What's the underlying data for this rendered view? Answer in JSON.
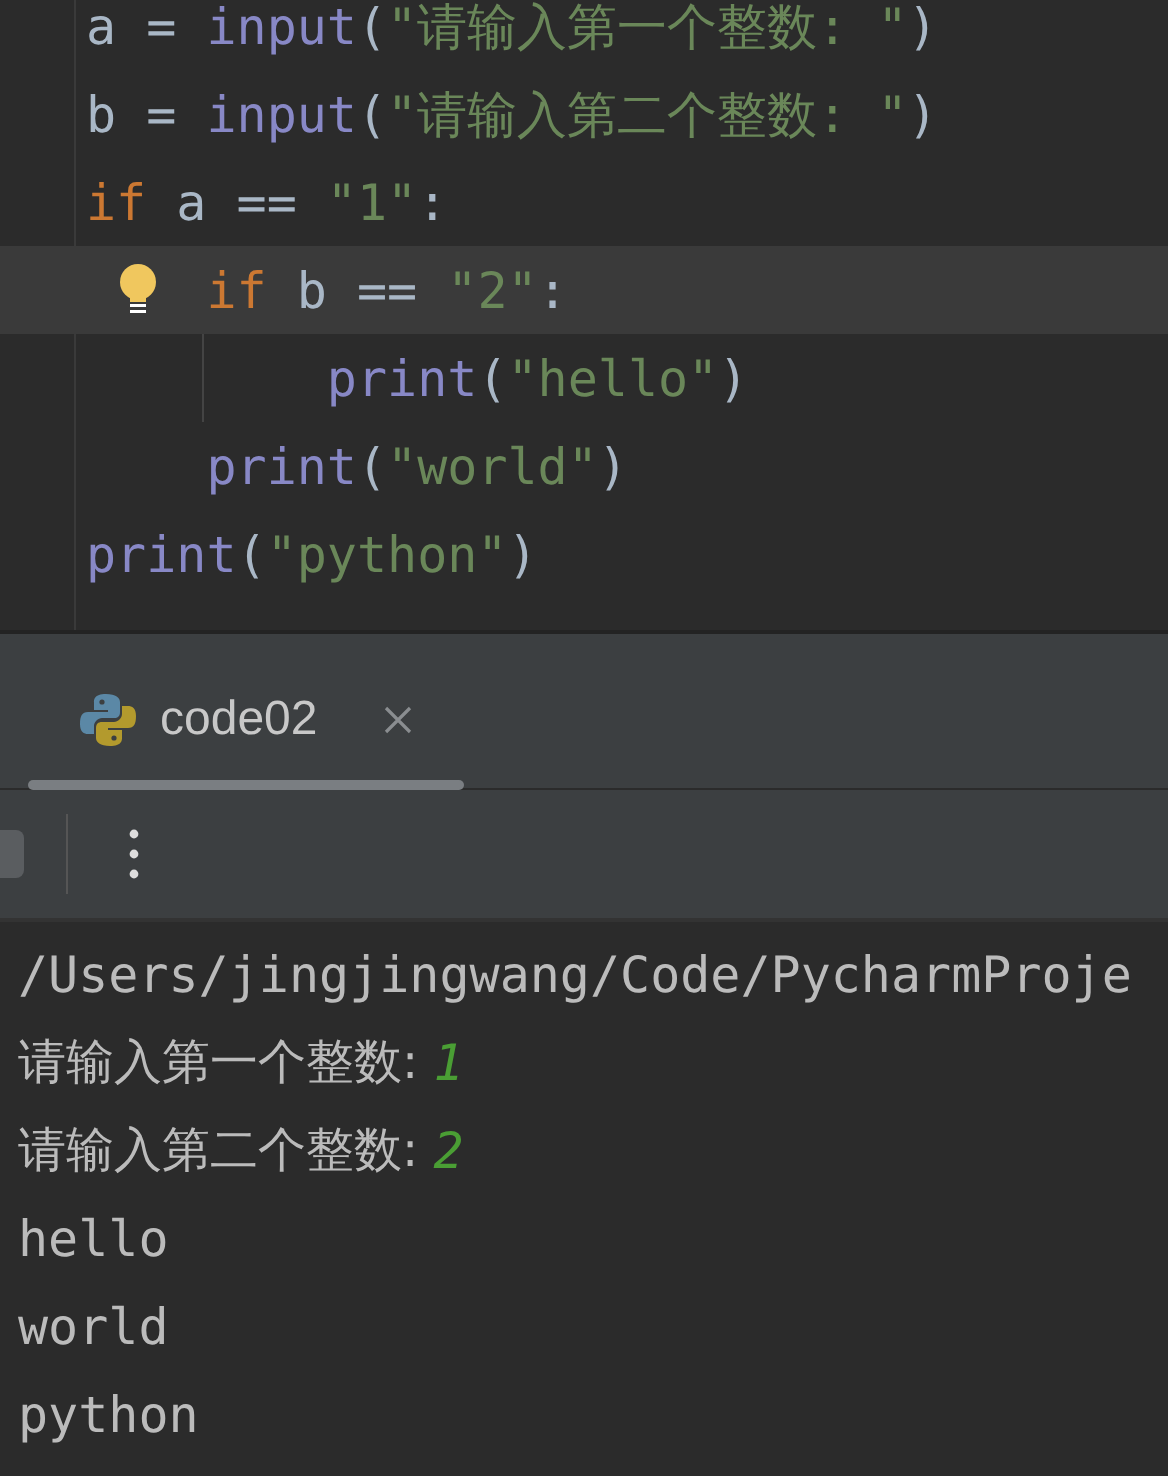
{
  "editor": {
    "lines": [
      {
        "highlighted": false,
        "bulb": false,
        "guide": false,
        "tokens": [
          {
            "kind": "plain",
            "text": "a = "
          },
          {
            "kind": "builtin",
            "text": "input"
          },
          {
            "kind": "plain",
            "text": "("
          },
          {
            "kind": "string",
            "text": "\"请输入第一个整数: \""
          },
          {
            "kind": "plain",
            "text": ")"
          }
        ]
      },
      {
        "highlighted": false,
        "bulb": false,
        "guide": false,
        "tokens": [
          {
            "kind": "plain",
            "text": "b = "
          },
          {
            "kind": "builtin",
            "text": "input"
          },
          {
            "kind": "plain",
            "text": "("
          },
          {
            "kind": "string",
            "text": "\"请输入第二个整数: \""
          },
          {
            "kind": "plain",
            "text": ")"
          }
        ]
      },
      {
        "highlighted": false,
        "bulb": false,
        "guide": false,
        "tokens": [
          {
            "kind": "keyword",
            "text": "if"
          },
          {
            "kind": "plain",
            "text": " a == "
          },
          {
            "kind": "string",
            "text": "\"1\""
          },
          {
            "kind": "plain",
            "text": ":"
          }
        ]
      },
      {
        "highlighted": true,
        "bulb": true,
        "guide": false,
        "tokens": [
          {
            "kind": "keyword",
            "text": "    if"
          },
          {
            "kind": "plain",
            "text": " b == "
          },
          {
            "kind": "string",
            "text": "\"2\""
          },
          {
            "kind": "plain",
            "text": ":"
          }
        ]
      },
      {
        "highlighted": false,
        "bulb": false,
        "guide": true,
        "tokens": [
          {
            "kind": "builtin",
            "text": "        print"
          },
          {
            "kind": "plain",
            "text": "("
          },
          {
            "kind": "string",
            "text": "\"hello\""
          },
          {
            "kind": "plain",
            "text": ")"
          }
        ]
      },
      {
        "highlighted": false,
        "bulb": false,
        "guide": false,
        "tokens": [
          {
            "kind": "builtin",
            "text": "    print"
          },
          {
            "kind": "plain",
            "text": "("
          },
          {
            "kind": "string",
            "text": "\"world\""
          },
          {
            "kind": "plain",
            "text": ")"
          }
        ]
      },
      {
        "highlighted": false,
        "bulb": false,
        "guide": false,
        "tokens": [
          {
            "kind": "builtin",
            "text": "print"
          },
          {
            "kind": "plain",
            "text": "("
          },
          {
            "kind": "string",
            "text": "\"python\""
          },
          {
            "kind": "plain",
            "text": ")"
          }
        ]
      }
    ]
  },
  "run_tabs": [
    {
      "label": "code02",
      "selected": true
    }
  ],
  "console": [
    {
      "kind": "text",
      "text": "/Users/jingjingwang/Code/PycharmProje"
    },
    {
      "kind": "input",
      "prompt": "请输入第一个整数: ",
      "value": "1"
    },
    {
      "kind": "input",
      "prompt": "请输入第二个整数: ",
      "value": "2"
    },
    {
      "kind": "text",
      "text": "hello"
    },
    {
      "kind": "text",
      "text": "world"
    },
    {
      "kind": "text",
      "text": "python"
    }
  ]
}
